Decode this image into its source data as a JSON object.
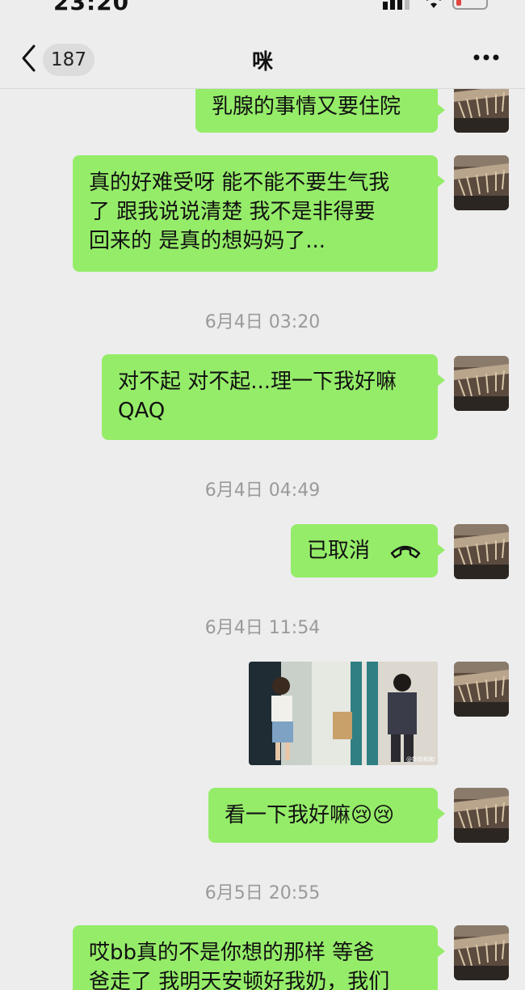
{
  "status_bar": {
    "time": "23:20"
  },
  "header": {
    "unread_count": "187",
    "title": "咪"
  },
  "messages": {
    "m1": "乳腺的事情又要住院",
    "m2_line1": "真的好难受呀 能不能不要生气我",
    "m2_line2": "了 跟我说说清楚 我不是非得要",
    "m2_line3": "回来的 是真的想妈妈了...",
    "ts1": "6月4日 03:20",
    "m3_line1": "对不起 对不起...理一下我好嘛",
    "m3_line2": "QAQ",
    "ts2": "6月4日 04:49",
    "m4": "已取消",
    "ts3": "6月4日 11:54",
    "m5": "看一下我好嘛",
    "m5_emoji": "😢😢",
    "ts4": "6月5日 20:55",
    "m6_line1": "哎bb真的不是你想的那样 等爸",
    "m6_line2": "爸走了 我明天安顿好我奶，我们"
  },
  "video": {
    "watermark": "@妙妙和和"
  },
  "colors": {
    "bubble": "#95ec69",
    "background": "#ededed",
    "timestamp": "#9a9a9a"
  },
  "icons": {
    "back": "chevron-left-icon",
    "more": "more-dots-icon",
    "call": "phone-hangup-icon"
  }
}
